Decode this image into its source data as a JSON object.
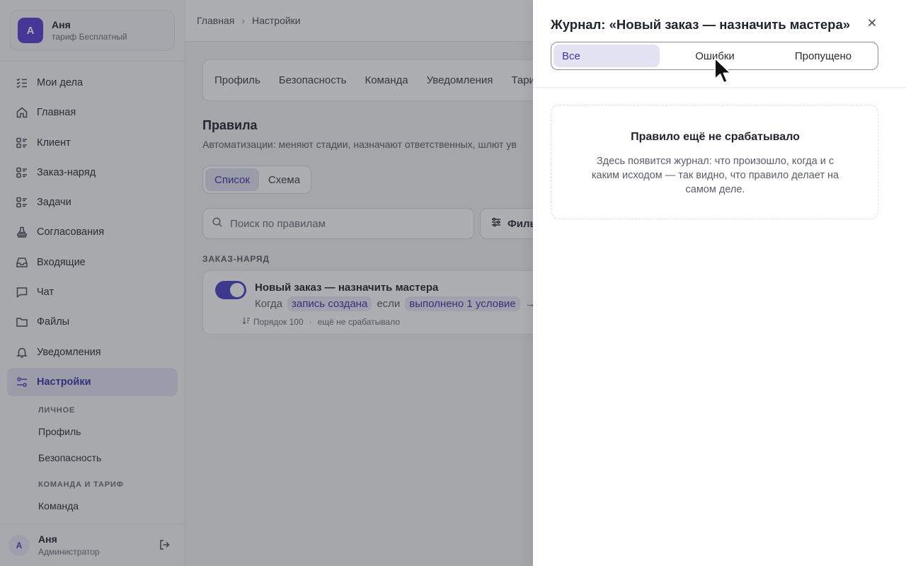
{
  "workspace": {
    "avatar_letter": "А",
    "name": "Аня",
    "plan": "тариф Бесплатный"
  },
  "sidebar": {
    "items": [
      {
        "label": "Мои дела",
        "icon": "checklist-icon"
      },
      {
        "label": "Главная",
        "icon": "home-icon"
      },
      {
        "label": "Клиент",
        "icon": "list-icon"
      },
      {
        "label": "Заказ-наряд",
        "icon": "list-icon"
      },
      {
        "label": "Задачи",
        "icon": "list-icon"
      },
      {
        "label": "Согласования",
        "icon": "stamp-icon"
      },
      {
        "label": "Входящие",
        "icon": "inbox-icon"
      },
      {
        "label": "Чат",
        "icon": "chat-icon"
      },
      {
        "label": "Файлы",
        "icon": "folder-icon"
      },
      {
        "label": "Уведомления",
        "icon": "bell-icon"
      },
      {
        "label": "Настройки",
        "icon": "settings-sliders-icon",
        "active": true
      }
    ],
    "sub_personal_head": "ЛИЧНОЕ",
    "sub_profile": "Профиль",
    "sub_security": "Безопасность",
    "sub_team_head": "КОМАНДА И ТАРИФ",
    "sub_team": "Команда"
  },
  "user": {
    "avatar_letter": "А",
    "name": "Аня",
    "role": "Администратор"
  },
  "breadcrumb": {
    "home": "Главная",
    "current": "Настройки"
  },
  "settings_tabs": [
    "Профиль",
    "Безопасность",
    "Команда",
    "Уведомления",
    "Тари"
  ],
  "rules": {
    "title": "Правила",
    "subtitle": "Автоматизации: меняют стадии, назначают ответственных, шлют ув",
    "view_list": "Список",
    "view_schema": "Схема",
    "search_placeholder": "Поиск по правилам",
    "filter_label": "Фильт",
    "section": "ЗАКАЗ-НАРЯД",
    "rule": {
      "enabled": true,
      "title": "Новый заказ — назначить мастера",
      "when": "Когда",
      "trigger": "запись создана",
      "if": "если",
      "condition": "выполнено 1 условие",
      "arrow": "→",
      "order": "Порядок 100",
      "sep": "·",
      "status": "ещё не срабатывало"
    }
  },
  "drawer": {
    "title": "Журнал: «Новый заказ — назначить мастера»",
    "tabs": {
      "all": "Все",
      "errors": "Ошибки",
      "skipped": "Пропущено"
    },
    "active_tab": "all",
    "empty_title": "Правило ещё не срабатывало",
    "empty_desc": "Здесь появится журнал: что произошло, когда и с каким исходом — так видно, что правило делает на самом деле."
  },
  "colors": {
    "accent": "#4b45c6",
    "accent_soft": "#e3e3f3",
    "overlay": "#282a32"
  }
}
